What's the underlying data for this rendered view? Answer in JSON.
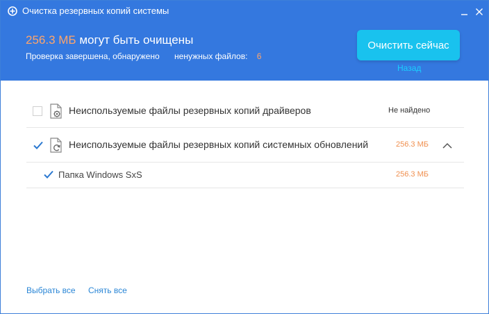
{
  "window": {
    "title": "Очистка резервных копий системы"
  },
  "header": {
    "size": "256.3 МБ",
    "headline_rest": "могут быть очищены",
    "scan_text": "Проверка завершена, обнаружено",
    "files_label": "ненужных файлов:",
    "files_count": "6",
    "clean_button": "Очистить сейчас",
    "back_link": "Назад"
  },
  "categories": [
    {
      "label": "Неиспользуемые файлы резервных копий драйверов",
      "checked": false,
      "status": "Не найдено",
      "icon": "gear-page-icon"
    },
    {
      "label": "Неиспользуемые файлы резервных копий системных обновлений",
      "checked": true,
      "status": "256.3 МБ",
      "icon": "refresh-page-icon",
      "expanded": true,
      "children": [
        {
          "label": "Папка Windows SxS",
          "checked": true,
          "status": "256.3 МБ"
        }
      ]
    }
  ],
  "footer": {
    "select_all": "Выбрать все",
    "deselect_all": "Снять все"
  },
  "colors": {
    "header_bg": "#3478df",
    "accent_orange": "#ffa56b",
    "button": "#19c2ee",
    "link": "#2a86d6"
  }
}
